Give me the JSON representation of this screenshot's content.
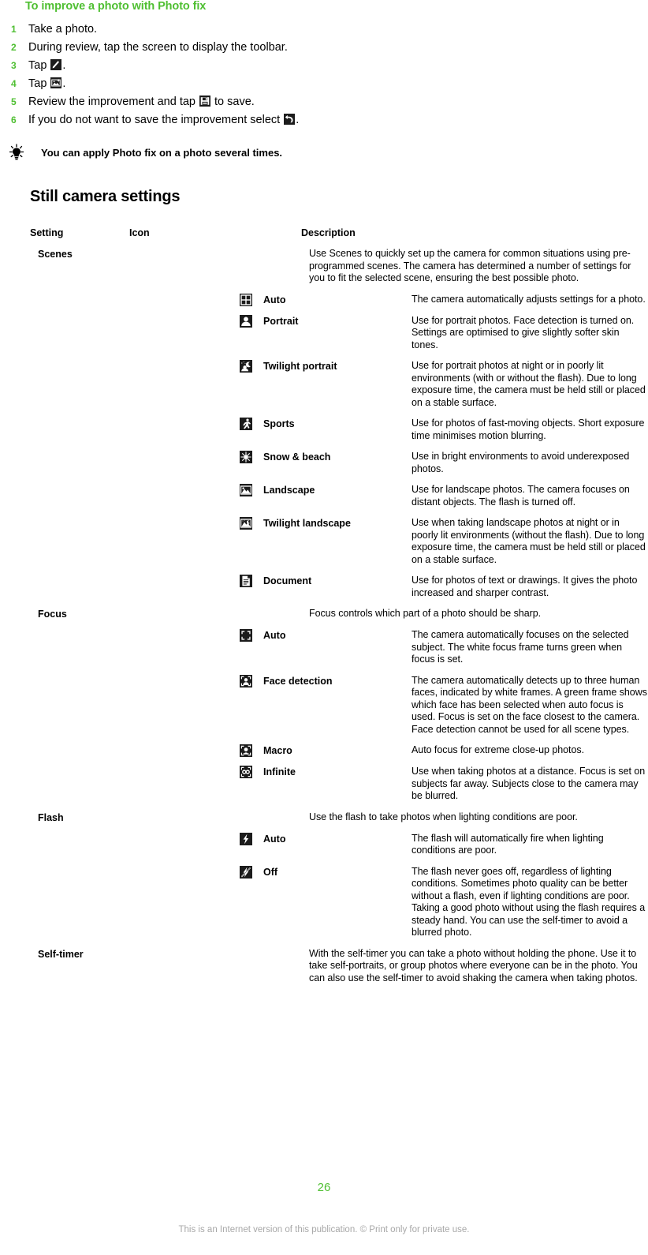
{
  "procedure": {
    "heading": "To improve a photo with Photo fix",
    "steps": [
      {
        "num": "1",
        "before": "Take a photo.",
        "icon": null,
        "after": ""
      },
      {
        "num": "2",
        "before": "During review, tap the screen to display the toolbar.",
        "icon": null,
        "after": ""
      },
      {
        "num": "3",
        "before": "Tap ",
        "icon": "edit-pencil-icon",
        "after": "."
      },
      {
        "num": "4",
        "before": "Tap ",
        "icon": "photo-fix-icon",
        "after": "."
      },
      {
        "num": "5",
        "before": "Review the improvement and tap ",
        "icon": "save-floppy-icon",
        "after": " to save."
      },
      {
        "num": "6",
        "before": "If you do not want to save the improvement select ",
        "icon": "undo-arrow-icon",
        "after": "."
      }
    ]
  },
  "tip": {
    "icon": "lightbulb-icon",
    "text": "You can apply Photo fix on a photo several times."
  },
  "section": {
    "heading": "Still camera settings"
  },
  "table": {
    "headers": {
      "setting": "Setting",
      "icon": "Icon",
      "description": "Description"
    },
    "rows": [
      {
        "type": "group",
        "setting": "Scenes",
        "icon": null,
        "icon_label": "",
        "description": "Use Scenes to quickly set up the camera for common situations using pre-programmed scenes. The camera has determined a number of settings for you to fit the selected scene, ensuring the best possible photo."
      },
      {
        "type": "sub",
        "setting": "",
        "icon": "scene-auto-icon",
        "icon_label": "Auto",
        "description": "The camera automatically adjusts settings for a photo."
      },
      {
        "type": "sub",
        "setting": "",
        "icon": "scene-portrait-icon",
        "icon_label": "Portrait",
        "description": "Use for portrait photos. Face detection is turned on. Settings are optimised to give slightly softer skin tones."
      },
      {
        "type": "sub",
        "setting": "",
        "icon": "scene-twilight-portrait-icon",
        "icon_label": "Twilight portrait",
        "description": "Use for portrait photos at night or in poorly lit environments (with or without the flash). Due to long exposure time, the camera must be held still or placed on a stable surface."
      },
      {
        "type": "sub",
        "setting": "",
        "icon": "scene-sports-icon",
        "icon_label": "Sports",
        "description": "Use for photos of fast-moving objects. Short exposure time minimises motion blurring."
      },
      {
        "type": "sub",
        "setting": "",
        "icon": "scene-snow-beach-icon",
        "icon_label": "Snow & beach",
        "description": "Use in bright environments to avoid underexposed photos."
      },
      {
        "type": "sub",
        "setting": "",
        "icon": "scene-landscape-icon",
        "icon_label": "Landscape",
        "description": "Use for landscape photos. The camera focuses on distant objects. The flash is turned off."
      },
      {
        "type": "sub",
        "setting": "",
        "icon": "scene-twilight-landscape-icon",
        "icon_label": "Twilight landscape",
        "description": "Use when taking landscape photos at night or in poorly lit environments (without the flash). Due to long exposure time, the camera must be held still or placed on a stable surface."
      },
      {
        "type": "sub",
        "setting": "",
        "icon": "scene-document-icon",
        "icon_label": "Document",
        "description": "Use for photos of text or drawings. It gives the photo increased and sharper contrast."
      },
      {
        "type": "group",
        "setting": "Focus",
        "icon": null,
        "icon_label": "",
        "description": "Focus controls which part of a photo should be sharp."
      },
      {
        "type": "sub",
        "setting": "",
        "icon": "focus-auto-icon",
        "icon_label": "Auto",
        "description": "The camera automatically focuses on the selected subject. The white focus frame turns green when focus is set."
      },
      {
        "type": "sub",
        "setting": "",
        "icon": "focus-face-detection-icon",
        "icon_label": "Face detection",
        "description": "The camera automatically detects up to three human faces, indicated by white frames. A green frame shows which face has been selected when auto focus is used. Focus is set on the face closest to the camera. Face detection cannot be used for all scene types."
      },
      {
        "type": "sub",
        "setting": "",
        "icon": "focus-macro-icon",
        "icon_label": "Macro",
        "description": "Auto focus for extreme close-up photos."
      },
      {
        "type": "sub",
        "setting": "",
        "icon": "focus-infinite-icon",
        "icon_label": "Infinite",
        "description": "Use when taking photos at a distance. Focus is set on subjects far away. Subjects close to the camera may be blurred."
      },
      {
        "type": "group",
        "setting": "Flash",
        "icon": null,
        "icon_label": "",
        "description": "Use the flash to take photos when lighting conditions are poor."
      },
      {
        "type": "sub",
        "setting": "",
        "icon": "flash-auto-icon",
        "icon_label": "Auto",
        "description": "The flash will automatically fire when lighting conditions are poor."
      },
      {
        "type": "sub",
        "setting": "",
        "icon": "flash-off-icon",
        "icon_label": "Off",
        "description": "The flash never goes off, regardless of lighting conditions. Sometimes photo quality can be better without a flash, even if lighting conditions are poor. Taking a good photo without using the flash requires a steady hand. You can use the self-timer to avoid a blurred photo."
      },
      {
        "type": "group",
        "setting": "Self-timer",
        "icon": null,
        "icon_label": "",
        "description": "With the self-timer you can take a photo without holding the phone. Use it to take self-portraits, or group photos where everyone can be in the photo. You can also use the self-timer to avoid shaking the camera when taking photos."
      }
    ]
  },
  "footer": {
    "page_number": "26",
    "note": "This is an Internet version of this publication. © Print only for private use."
  },
  "colors": {
    "accent_green": "#4fbf32",
    "icon_background": "#1c1c1c",
    "footer_grey": "#a8a8a8"
  }
}
